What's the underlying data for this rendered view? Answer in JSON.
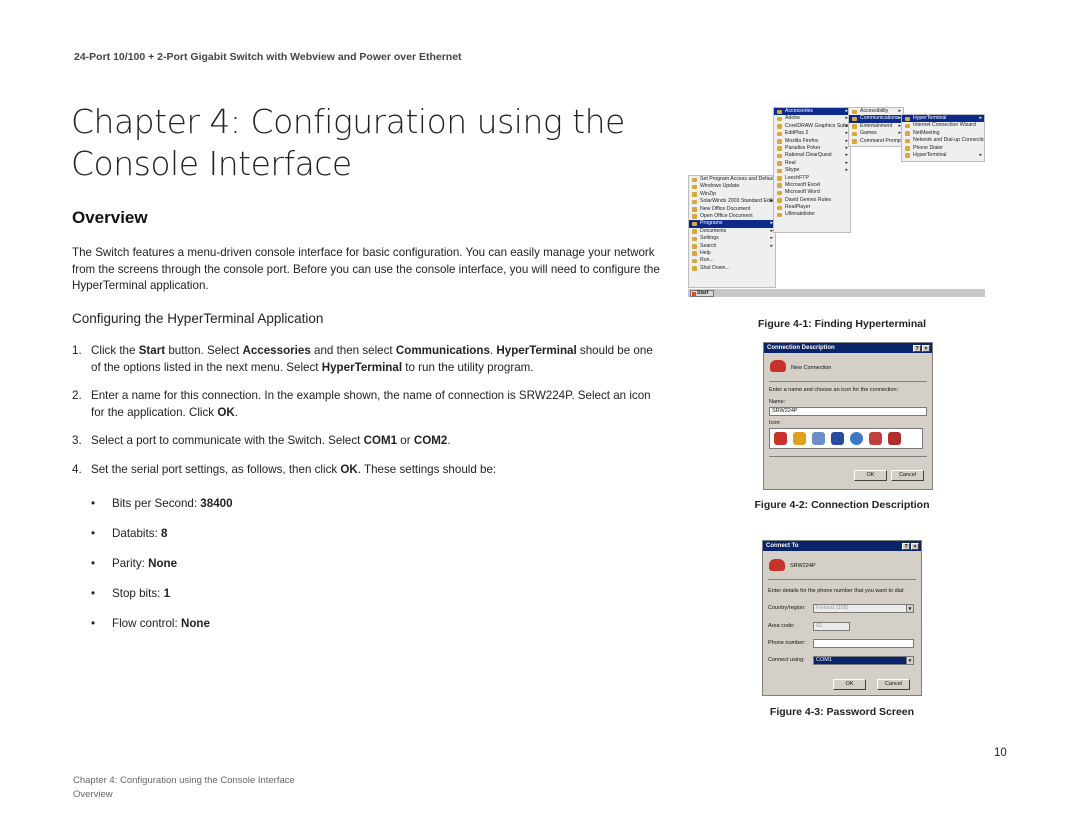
{
  "header": {
    "running_title": "24-Port 10/100 + 2-Port Gigabit Switch with Webview and Power over Ethernet"
  },
  "chapter": {
    "title_line1": "Chapter 4: Configuration using the",
    "title_line2": "Console Interface"
  },
  "overview": {
    "heading": "Overview",
    "intro": "The Switch features a menu-driven console interface for basic configuration. You can easily manage your network from the screens through the console port. Before you can use the console interface, you will need to configure the HyperTerminal application."
  },
  "hyperterminal": {
    "heading": "Configuring the HyperTerminal Application",
    "steps": [
      {
        "num": "1.",
        "parts": [
          "Click the ",
          "Start",
          " button. Select ",
          "Accessories",
          " and then select ",
          "Communications",
          ". ",
          "HyperTerminal",
          " should be one of the options listed in the next menu. Select ",
          "HyperTerminal",
          " to run the utility program."
        ]
      },
      {
        "num": "2.",
        "parts": [
          "Enter a name for this connection. In the example shown, the name of connection is SRW224P. Select an icon for the application. Click ",
          "OK",
          "."
        ]
      },
      {
        "num": "3.",
        "parts": [
          "Select a port to communicate with the Switch. Select ",
          "COM1",
          " or ",
          "COM2",
          "."
        ]
      },
      {
        "num": "4.",
        "parts": [
          "Set the serial port settings, as follows, then click ",
          "OK",
          ". These settings should be:"
        ]
      }
    ],
    "settings": [
      {
        "label": "Bits per Second: ",
        "value": "38400"
      },
      {
        "label": "Databits: ",
        "value": "8"
      },
      {
        "label": "Parity: ",
        "value": "None"
      },
      {
        "label": "Stop bits: ",
        "value": "1"
      },
      {
        "label": "Flow control: ",
        "value": "None"
      }
    ]
  },
  "figures": {
    "fig1": {
      "caption": "Figure 4-1: Finding Hyperterminal",
      "start_label": "Start",
      "start_menu": [
        "Set Program Access and Defaults",
        "Windows Update",
        "WinZip",
        "SolarWinds 2003 Standard Edition",
        "New Office Document",
        "Open Office Document",
        "Programs",
        "Documents",
        "Settings",
        "Search",
        "Help",
        "Run...",
        "Shut Down..."
      ],
      "programs_menu": [
        "Accessories",
        "Adobe",
        "CorelDRAW Graphics Suite 12",
        "EditPlus 2",
        "Mozilla Firefox",
        "Paradise Poker",
        "Rational ClearQuest",
        "Real",
        "Skype",
        "LeechFTP",
        "Microsoft Excel",
        "Microsoft Word",
        "David Gemes Rules",
        "RealPlayer",
        "Ultimatelister"
      ],
      "accessories_menu": [
        "Accessibility",
        "Communications",
        "Entertainment",
        "Games",
        "Command Prompt"
      ],
      "communications_menu": [
        "HyperTerminal",
        "Internet Connection Wizard",
        "NetMeeting",
        "Network and Dial-up Connections",
        "Phone Dialer",
        "HyperTerminal"
      ]
    },
    "fig2": {
      "caption": "Figure 4-2: Connection Description",
      "title": "Connection Description",
      "heading": "New Connection",
      "prompt": "Enter a name and choose an icon for the connection:",
      "name_label": "Name:",
      "name_value": "SRW224P",
      "icon_label": "Icon:",
      "ok": "OK",
      "cancel": "Cancel"
    },
    "fig3": {
      "caption": "Figure 4-3: Password Screen",
      "title": "Connect To",
      "connection_name": "SRW224P",
      "prompt": "Enter details for the phone number that you want to dial:",
      "country_label": "Country/region:",
      "country_value": "Finland (358)",
      "area_label": "Area code:",
      "area_value": "02",
      "phone_label": "Phone number:",
      "phone_value": "",
      "connect_label": "Connect using:",
      "connect_value": "COM1",
      "ok": "OK",
      "cancel": "Cancel"
    }
  },
  "page_number": "10",
  "footer": {
    "line1": "Chapter 4: Configuration using the Console Interface",
    "line2": "Overview"
  }
}
